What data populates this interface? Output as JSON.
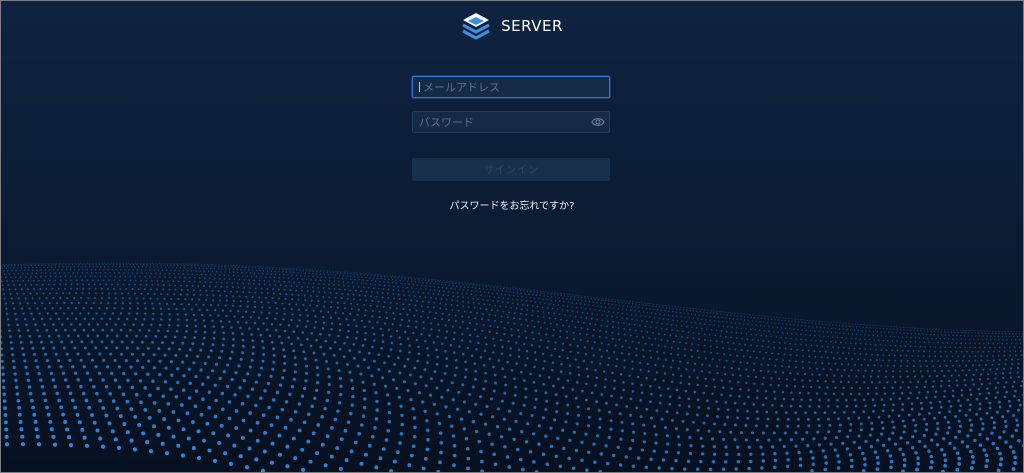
{
  "brand": {
    "name": "SERVER",
    "logo_icon": "stacked-layers-icon",
    "logo_color": "#3f8fe0"
  },
  "login": {
    "email_placeholder": "メールアドレス",
    "email_value": "",
    "password_placeholder": "パスワード",
    "password_value": "",
    "password_toggle_icon": "eye-icon",
    "signin_label": "サインイン",
    "forgot_password_link": "パスワードをお忘れですか?"
  },
  "theme": {
    "background": "#0b1a31",
    "accent": "#2f77d6",
    "dot_color": "#2d8fe6"
  }
}
